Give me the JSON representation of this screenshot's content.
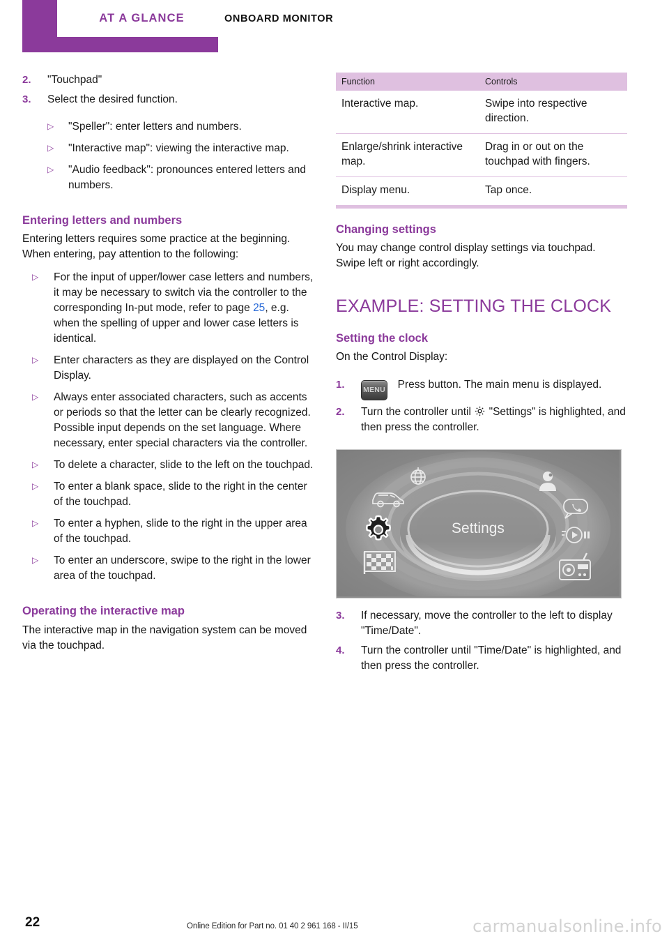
{
  "header": {
    "tab_label": "AT A GLANCE",
    "chapter_label": "ONBOARD MONITOR"
  },
  "colors": {
    "accent_purple": "#8b3a9b",
    "table_header_bg": "#dfc0e0",
    "link_blue": "#2a6bd8"
  },
  "left_column": {
    "steps": [
      {
        "num": "2.",
        "text": "\"Touchpad\""
      },
      {
        "num": "3.",
        "text": "Select the desired function."
      }
    ],
    "step_sub_bullets": [
      "\"Speller\": enter letters and numbers.",
      "\"Interactive map\": viewing the interactive map.",
      "\"Audio feedback\": pronounces entered letters and numbers."
    ],
    "section_entering": {
      "heading": "Entering letters and numbers",
      "intro": "Entering letters requires some practice at the beginning. When entering, pay attention to the following:",
      "bullets_part1": "For the input of upper/lower case letters and numbers, it may be necessary to switch via the controller to the corresponding In-put mode, refer to page ",
      "bullets_part1_link": "25",
      "bullets_part1_rest": ", e.g. when the spelling of upper and lower case letters is identical.",
      "bullets": [
        "Enter characters as they are displayed on the Control Display.",
        "Always enter associated characters, such as accents or periods so that the letter can be clearly recognized. Possible input depends on the set language. Where necessary, enter special characters via the controller.",
        "To delete a character, slide to the left on the touchpad.",
        "To enter a blank space, slide to the right in the center of the touchpad.",
        "To enter a hyphen, slide to the right in the upper area of the touchpad.",
        "To enter an underscore, swipe to the right in the lower area of the touchpad."
      ]
    },
    "section_interactive_map": {
      "heading": "Operating the interactive map",
      "body": "The interactive map in the navigation system can be moved via the touchpad."
    }
  },
  "right_column": {
    "table": {
      "headers": [
        "Function",
        "Controls"
      ],
      "rows": [
        [
          "Interactive map.",
          "Swipe into respective direction."
        ],
        [
          "Enlarge/shrink interactive map.",
          "Drag in or out on the touchpad with fingers."
        ],
        [
          "Display menu.",
          "Tap once."
        ]
      ]
    },
    "section_changing": {
      "heading": "Changing settings",
      "body": "You may change control display settings via touchpad. Swipe left or right accordingly."
    },
    "chapter_title": "EXAMPLE: SETTING THE CLOCK",
    "section_setting": {
      "heading": "Setting the clock",
      "intro": "On the Control Display:"
    },
    "steps": [
      {
        "num": "1.",
        "icon": "menu-button-icon",
        "icon_label": "MENU",
        "text": "Press button. The main menu is displayed."
      },
      {
        "num": "2.",
        "text_before": "Turn the controller until",
        "icon": "gear-icon",
        "text_after": "\"Settings\" is highlighted, and then press the controller."
      },
      {
        "num": "3.",
        "text": "If necessary, move the controller to the left to display \"Time/Date\"."
      },
      {
        "num": "4.",
        "text": "Turn the controller until \"Time/Date\" is highlighted, and then press the controller."
      }
    ],
    "figure": {
      "center_label": "Settings",
      "icons": [
        "globe-icon",
        "vehicle-icon",
        "gear-settings-icon",
        "checkered-flag-icon",
        "person-icon",
        "phone-speech-bubble-icon",
        "media-player-icon",
        "radio-icon"
      ]
    }
  },
  "footer": {
    "page_number": "22",
    "edition": "Online Edition for Part no. 01 40 2 961 168 - II/15",
    "watermark": "carmanualsonline.info"
  }
}
